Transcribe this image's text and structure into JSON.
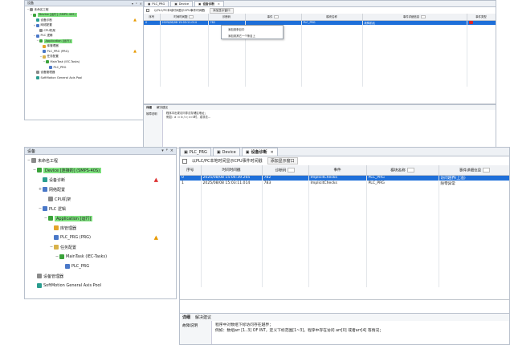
{
  "screenshot1": {
    "tree": {
      "header": "设备",
      "items": [
        {
          "label": "未命名工程",
          "level": 0,
          "exp": "−",
          "icon": "project-icon",
          "color": "gray"
        },
        {
          "label": "Device [运行] (SMPS-40S)",
          "level": 1,
          "exp": "−",
          "icon": "device-icon",
          "color": "green",
          "hl": true
        },
        {
          "label": "设备诊断",
          "level": 2,
          "exp": "",
          "icon": "diagnosis-icon",
          "color": "teal",
          "warn": "▲"
        },
        {
          "label": "网络配置",
          "level": 2,
          "exp": "+",
          "icon": "network-icon",
          "color": "blue"
        },
        {
          "label": "CPU机架",
          "level": 3,
          "exp": "",
          "icon": "cpu-rack-icon",
          "color": "gray"
        },
        {
          "label": "PLC 逻辑",
          "level": 2,
          "exp": "−",
          "icon": "plc-logic-icon",
          "color": "blue"
        },
        {
          "label": "Application [运行]",
          "level": 3,
          "exp": "−",
          "icon": "application-icon",
          "color": "green",
          "hl": true
        },
        {
          "label": "库管理器",
          "level": 4,
          "exp": "",
          "icon": "library-icon",
          "color": "orange"
        },
        {
          "label": "PLC_PRG (PRG)",
          "level": 4,
          "exp": "",
          "icon": "program-icon",
          "color": "blue",
          "warn": "▲"
        },
        {
          "label": "任务配置",
          "level": 4,
          "exp": "−",
          "icon": "task-config-icon",
          "color": "folder"
        },
        {
          "label": "MainTask (IEC-Tasks)",
          "level": 5,
          "exp": "−",
          "icon": "task-icon",
          "color": "green"
        },
        {
          "label": "PLC_PRG",
          "level": 6,
          "exp": "",
          "icon": "program-icon",
          "color": "blue"
        },
        {
          "label": "设备管理器",
          "level": 2,
          "exp": "",
          "icon": "device-manager-icon",
          "color": "gray"
        },
        {
          "label": "SoftMotion General Axis Pool",
          "level": 2,
          "exp": "",
          "icon": "softmotion-icon",
          "color": "teal"
        }
      ]
    },
    "tabs": [
      {
        "label": "PLC_PRG",
        "icon": "program-icon"
      },
      {
        "label": "Device",
        "icon": "device-icon"
      },
      {
        "label": "设备诊断",
        "icon": "diagnosis-icon",
        "active": true
      }
    ],
    "options": {
      "checkbox_label": "以PLC/PC本地时间显示CPU事件时间戳",
      "button_label": "添加显示窗口"
    },
    "columns": [
      "序号",
      "时间时间戳",
      "诊断码",
      "事件",
      "模块名称",
      "事件详细信息",
      "事件类型"
    ],
    "rows": [
      {
        "cells": [
          "0",
          "2025/08/08 15:03:11.014",
          "782",
          "",
          "PLC_PRG",
          "故障前兆",
          ""
        ],
        "selected": true
      }
    ],
    "context_menu": [
      "添加到条目中",
      "添加到其它一个条目上"
    ],
    "bottom_tabs": [
      "详细",
      "解决建议"
    ],
    "detail_label": "故障说明",
    "detail_lines": [
      "程序中出现访问非法存储区地址；",
      "例如：a := b / c; c=0时，或非法…"
    ]
  },
  "screenshot2": {
    "tree": {
      "header": "设备",
      "items": [
        {
          "label": "未命名工程",
          "level": 0,
          "exp": "−",
          "icon": "project-icon",
          "color": "gray"
        },
        {
          "label": "Device [连接的] (SMPS-40S)",
          "level": 1,
          "exp": "−",
          "icon": "device-icon",
          "color": "green",
          "hl": true
        },
        {
          "label": "设备诊断",
          "level": 2,
          "exp": "",
          "icon": "diagnosis-icon",
          "color": "teal",
          "warn": "▲",
          "warn_red": true
        },
        {
          "label": "网络配置",
          "level": 2,
          "exp": "+",
          "icon": "network-icon",
          "color": "blue"
        },
        {
          "label": "CPU机架",
          "level": 3,
          "exp": "",
          "icon": "cpu-rack-icon",
          "color": "gray"
        },
        {
          "label": "PLC 逻辑",
          "level": 2,
          "exp": "−",
          "icon": "plc-logic-icon",
          "color": "blue"
        },
        {
          "label": "Application [运行]",
          "level": 3,
          "exp": "−",
          "icon": "application-icon",
          "color": "green",
          "hl": true
        },
        {
          "label": "库管理器",
          "level": 4,
          "exp": "",
          "icon": "library-icon",
          "color": "orange"
        },
        {
          "label": "PLC_PRG (PRG)",
          "level": 4,
          "exp": "",
          "icon": "program-icon",
          "color": "blue",
          "warn": "▲"
        },
        {
          "label": "任务配置",
          "level": 4,
          "exp": "−",
          "icon": "task-config-icon",
          "color": "folder"
        },
        {
          "label": "MainTask (IEC-Tasks)",
          "level": 5,
          "exp": "−",
          "icon": "task-icon",
          "color": "green"
        },
        {
          "label": "PLC_PRG",
          "level": 6,
          "exp": "",
          "icon": "program-icon",
          "color": "blue"
        },
        {
          "label": "设备管理器",
          "level": 1,
          "exp": "",
          "icon": "device-manager-icon",
          "color": "gray"
        },
        {
          "label": "SoftMotion General Axis Pool",
          "level": 1,
          "exp": "",
          "icon": "softmotion-icon",
          "color": "teal"
        }
      ]
    },
    "tabs": [
      {
        "label": "PLC_PRG",
        "icon": "program-icon"
      },
      {
        "label": "Device",
        "icon": "device-icon"
      },
      {
        "label": "设备诊断",
        "icon": "diagnosis-icon",
        "active": true
      }
    ],
    "options": {
      "checkbox_label": "以PLC/PC本地时间显示CPU事件时间戳",
      "button_label": "添加显示窗口"
    },
    "columns": [
      "序号",
      "时间时间戳",
      "诊断码",
      "事件",
      "模块名称",
      "事件详细信息"
    ],
    "rows": [
      {
        "cells": [
          "0",
          "2025/08/08 15:04:39.265",
          "782",
          "ImplicitChecks",
          "PLC_PRG",
          "访问越界(上溢)"
        ],
        "selected": true
      },
      {
        "cells": [
          "1",
          "2025/08/08 15:03:11.014",
          "783",
          "ImplicitChecks",
          "PLC_PRG",
          "除零异常"
        ],
        "selected": false
      }
    ],
    "bottom_tabs": [
      "详细",
      "解决建议"
    ],
    "detail_label": "故障说明",
    "detail_lines": [
      "程序中对数组下标访问存在越界；",
      "例如：数组arr [1..3] OF INT，定义下标范围[1~3]，程序中存在访问 arr[0] 或者arr[4] 等情况；"
    ]
  },
  "colors": {
    "selection": "#1e6fd9",
    "highlight": "#7ce07c",
    "warning": "#e89a00",
    "error": "#e02424"
  }
}
